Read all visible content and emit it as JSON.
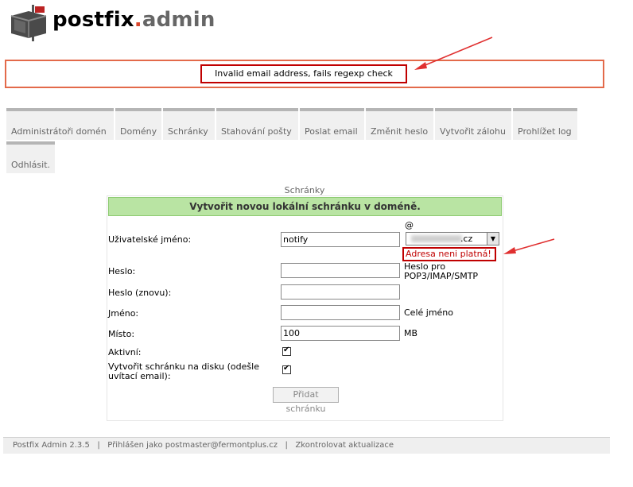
{
  "header": {
    "logo_part1": "postfix",
    "logo_dot": ".",
    "logo_part2": "admin"
  },
  "error_banner": {
    "message": "Invalid email address, fails regexp check"
  },
  "menu": {
    "items": [
      "Administrátoři domén",
      "Domény",
      "Schránky",
      "Stahování pošty",
      "Poslat email",
      "Změnit heslo",
      "Vytvořit zálohu",
      "Prohlížet log",
      "Odhlásit."
    ]
  },
  "form": {
    "caption": "Schránky",
    "title": "Vytvořit novou lokální schránku v doméně.",
    "username_label": "Uživatelské jméno:",
    "username_value": "notify",
    "at_sign": "@",
    "domain_suffix": ".cz",
    "domain_error": "Adresa neni platná!",
    "password_label": "Heslo:",
    "password_note": "Heslo pro POP3/IMAP/SMTP",
    "password_value": "",
    "password2_label": "Heslo (znovu):",
    "password2_value": "",
    "name_label": "Jméno:",
    "name_value": "",
    "name_note": "Celé jméno",
    "quota_label": "Místo:",
    "quota_value": "100",
    "quota_unit": "MB",
    "active_label": "Aktivní:",
    "active_checked": true,
    "mailbox_label": "Vytvořit schránku na disku (odešle uvítací email):",
    "mailbox_checked": true,
    "submit_label": "Přidat schránku"
  },
  "footer": {
    "version": "Postfix Admin 2.3.5",
    "logged_in": "Přihlášen jako postmaster@fermontplus.cz",
    "check_updates": "Zkontrolovat aktualizace",
    "separator": "|"
  },
  "colors": {
    "annotation_red": "#c00000",
    "arrow_red": "#e03030",
    "header_green": "#b9e4a3",
    "banner_border": "#e36a4a"
  }
}
